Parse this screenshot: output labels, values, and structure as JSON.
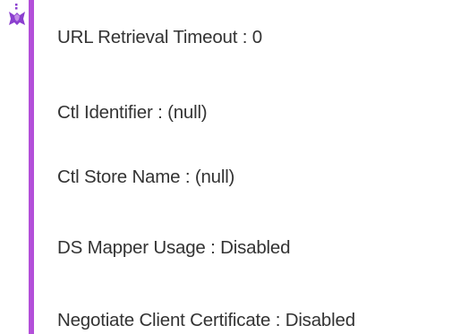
{
  "colors": {
    "accent_bar": "#b34fd9",
    "icon_primary": "#8b3fcf",
    "icon_secondary": "#c48de8",
    "text": "#333333"
  },
  "icon": {
    "name": "tool-icon"
  },
  "fields": [
    {
      "label": "URL Retrieval Timeout : 0"
    },
    {
      "label": "Ctl Identifier : (null)"
    },
    {
      "label": "Ctl Store Name : (null)"
    },
    {
      "label": "DS Mapper Usage : Disabled"
    },
    {
      "label": "Negotiate Client Certificate : Disabled"
    }
  ]
}
